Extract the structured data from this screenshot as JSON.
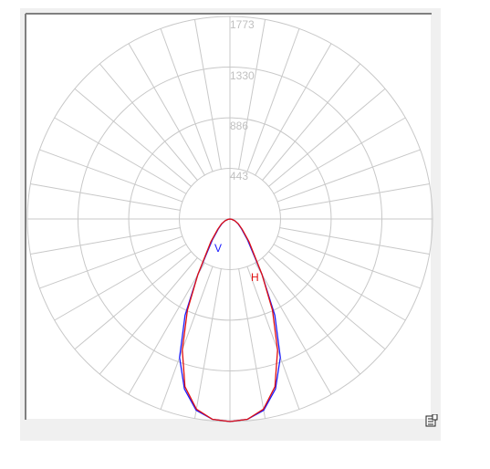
{
  "chart_data": {
    "type": "polar",
    "title": "",
    "radial_ticks": [
      "443",
      "886",
      "1330",
      "1773"
    ],
    "radial_values": [
      443,
      886,
      1330,
      1773
    ],
    "r_max": 1773,
    "angle_step_deg": 10,
    "grid": true,
    "series": [
      {
        "name": "V",
        "color": "#1a1aff",
        "angles_deg": [
          0,
          5,
          10,
          15,
          20,
          25,
          30,
          40,
          50,
          60,
          70,
          80,
          90
        ],
        "values": [
          1773,
          1760,
          1700,
          1540,
          1290,
          930,
          560,
          240,
          130,
          80,
          45,
          15,
          0
        ]
      },
      {
        "name": "H",
        "color": "#e01010",
        "angles_deg": [
          0,
          5,
          10,
          15,
          20,
          25,
          30,
          40,
          50,
          60,
          70,
          80,
          90
        ],
        "values": [
          1773,
          1760,
          1690,
          1520,
          1220,
          880,
          560,
          260,
          140,
          85,
          45,
          15,
          0
        ]
      }
    ]
  },
  "ui": {
    "corner_icon": "table-toggle-icon"
  }
}
